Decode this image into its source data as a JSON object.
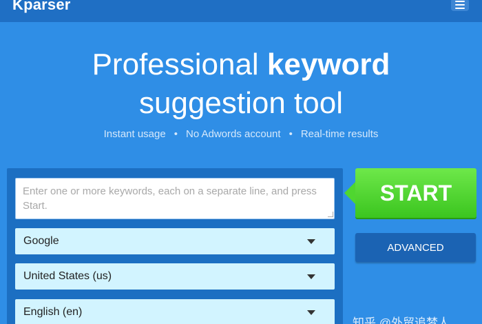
{
  "header": {
    "logo": "Kparser",
    "menu_icon": "hamburger-menu-icon"
  },
  "hero": {
    "line1_regular": "Professional ",
    "line1_bold": "keyword",
    "line2": "suggestion tool",
    "features": [
      "Instant usage",
      "No Adwords account",
      "Real-time results"
    ],
    "separator": "•"
  },
  "form": {
    "keywords_placeholder": "Enter one or more keywords, each on a separate line, and press Start.",
    "source": "Google",
    "country": "United States (us)",
    "language": "English (en)"
  },
  "actions": {
    "start_label": "START",
    "advanced_label": "ADVANCED"
  },
  "watermark": "知乎 @外贸追梦人",
  "colors": {
    "background": "#2f8ee6",
    "topbar": "#1f6fc4",
    "panel": "#1c6fc2",
    "select": "#d2f4ff",
    "start": "#4fd630",
    "advanced": "#1b63b3"
  }
}
